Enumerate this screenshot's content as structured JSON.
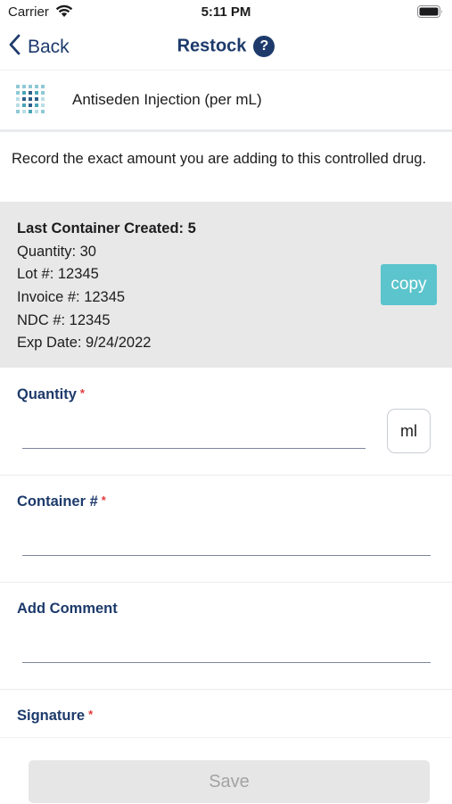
{
  "status_bar": {
    "carrier": "Carrier",
    "time": "5:11 PM"
  },
  "nav": {
    "back_label": "Back",
    "title": "Restock",
    "help_glyph": "?"
  },
  "drug": {
    "name": "Antiseden Injection (per mL)",
    "icon": "drug-dots-icon"
  },
  "instruction": "Record the exact amount you are adding to this controlled drug.",
  "last_container": {
    "title": "Last Container Created: 5",
    "lines": [
      "Quantity: 30",
      "Lot #: 12345",
      "Invoice #: 12345",
      "NDC #: 12345",
      "Exp Date: 9/24/2022"
    ],
    "copy_label": "copy"
  },
  "fields": {
    "quantity": {
      "label": "Quantity",
      "required_mark": "*",
      "value": "",
      "unit": "ml"
    },
    "container": {
      "label": "Container #",
      "required_mark": "*",
      "value": ""
    },
    "comment": {
      "label": "Add Comment",
      "value": ""
    },
    "signature": {
      "label": "Signature",
      "required_mark": "*"
    }
  },
  "save_label": "Save",
  "colors": {
    "brand": "#1d3a6b",
    "accent": "#5bc4cc",
    "required": "#e23b3b",
    "disabled_text": "#a3a3a3"
  }
}
